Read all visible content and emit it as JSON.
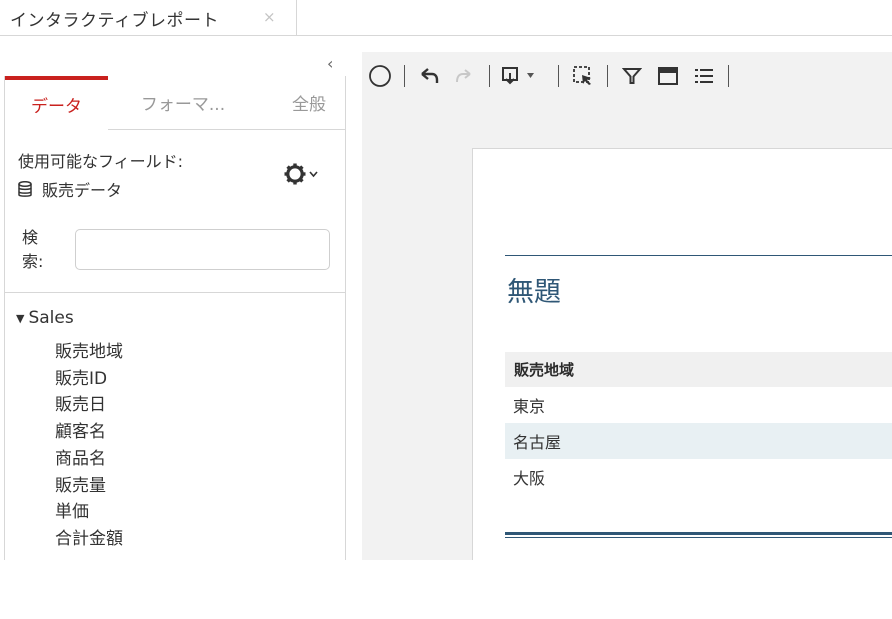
{
  "document_tab": {
    "title": "インタラクティブレポート",
    "close_glyph": "×"
  },
  "panel": {
    "collapse_glyph": "‹",
    "tabs": {
      "data": "データ",
      "format": "フォーマ...",
      "general": "全般"
    },
    "available_fields_label": "使用可能なフィールド:",
    "datasource_name": "販売データ",
    "search_label": "検索:",
    "search_value": "",
    "tree": {
      "root": "Sales",
      "items": [
        "販売地域",
        "販売ID",
        "販売日",
        "顧客名",
        "商品名",
        "販売量",
        "単価",
        "合計金額"
      ]
    }
  },
  "toolbar": {
    "icons": [
      "circle-icon",
      "undo-icon",
      "redo-icon",
      "insert-dropdown-icon",
      "select-icon",
      "filter-icon",
      "table-header-icon",
      "list-icon"
    ]
  },
  "report": {
    "title": "無題",
    "column_header": "販売地域",
    "rows": [
      "東京",
      "名古屋",
      "大阪"
    ]
  },
  "colors": {
    "accent_red": "#c9211e",
    "report_blue": "#2f5776",
    "row_alt": "#e8f0f3"
  }
}
